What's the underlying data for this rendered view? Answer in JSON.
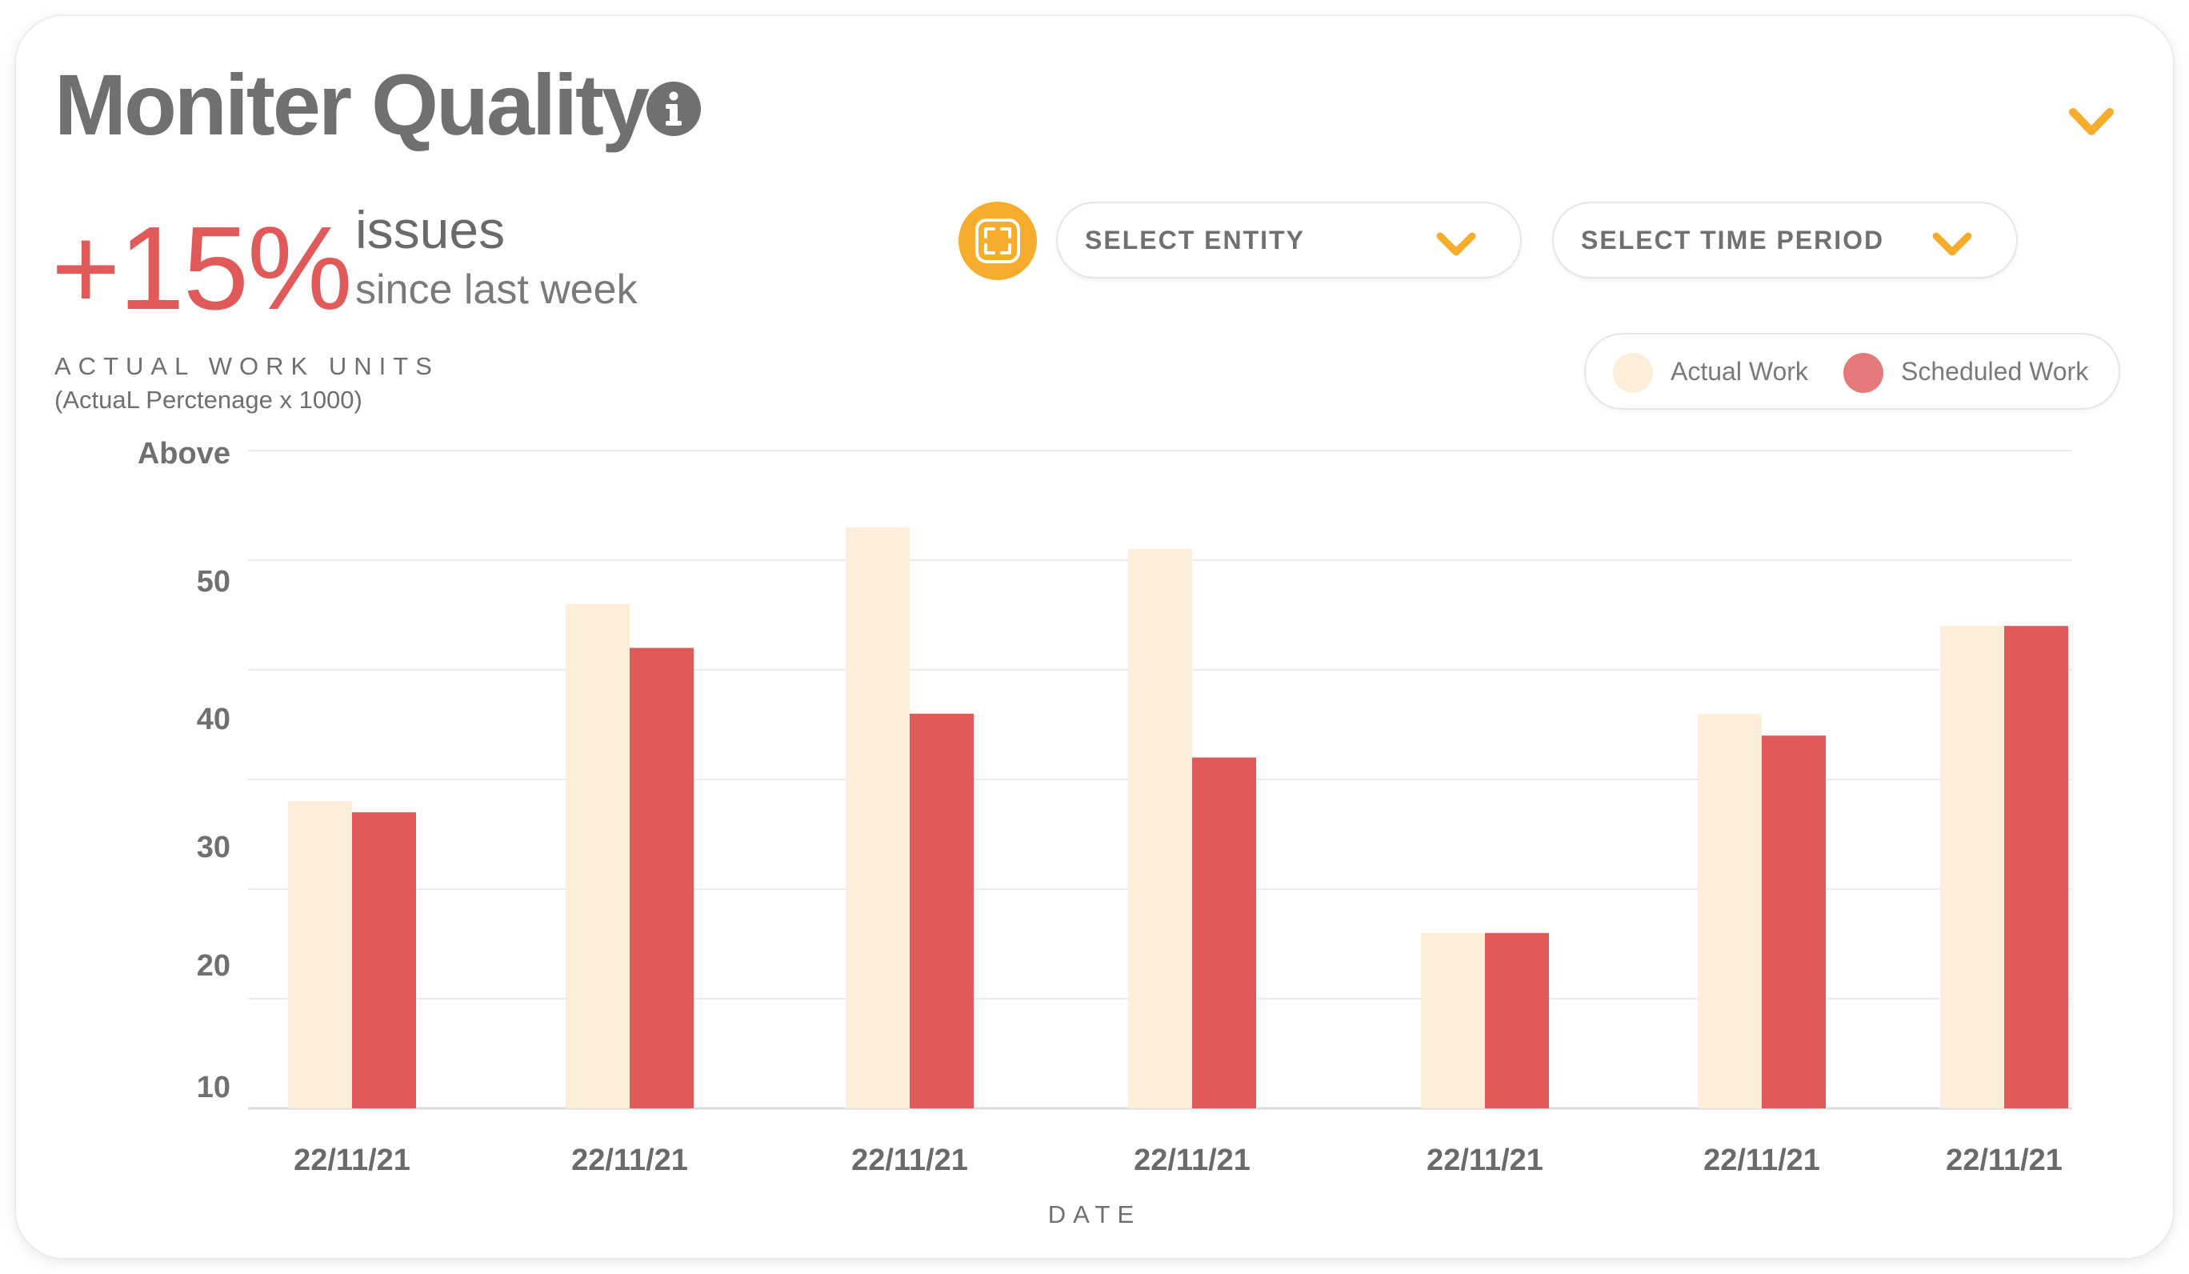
{
  "header": {
    "title": "Moniter Quality",
    "info_icon": "info-icon",
    "collapse_icon": "chevron-down-icon"
  },
  "summary": {
    "change": "+15%",
    "unit": "issues",
    "period": "since last week"
  },
  "filters": {
    "focus_icon": "focus-frame-icon",
    "entity_label": "SELECT ENTITY",
    "time_label": "SELECT TIME PERIOD"
  },
  "colors": {
    "accent": "#f6ad2d",
    "actual": "#fdeed9",
    "scheduled": "#e05a5a",
    "title": "#707070"
  },
  "chart_data": {
    "type": "bar",
    "ylabel": "ACTUAL WORK UNITS",
    "ylabel_sub": "(ActuaL Perctenage x 1000)",
    "xlabel": "DATE",
    "categories": [
      "22/11/21",
      "22/11/21",
      "22/11/21",
      "22/11/21",
      "22/11/21",
      "22/11/21",
      "22/11/21"
    ],
    "series": [
      {
        "name": "Actual Work",
        "values": [
          38,
          56,
          63,
          61,
          26,
          46,
          54
        ]
      },
      {
        "name": "Scheduled Work",
        "values": [
          37,
          52,
          46,
          42,
          26,
          44,
          54
        ]
      }
    ],
    "y_ticks": [
      "10",
      "20",
      "30",
      "40",
      "50",
      "Above"
    ],
    "ylim": [
      10,
      70
    ],
    "grid": true,
    "legend": "top-right"
  }
}
